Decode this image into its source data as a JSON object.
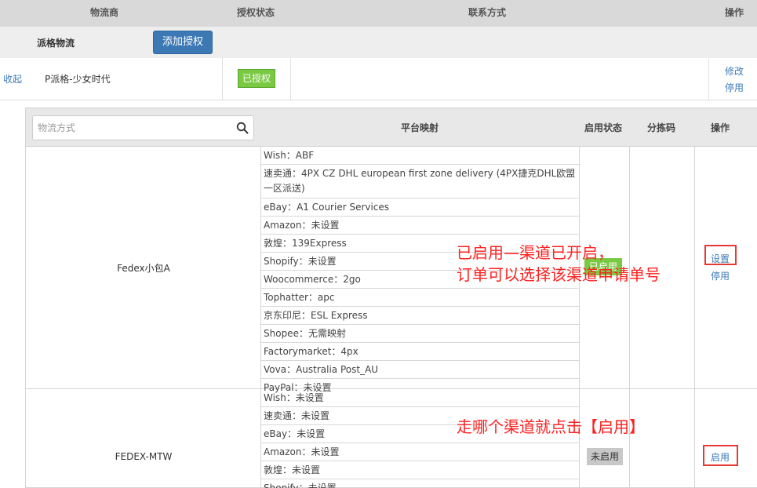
{
  "header": {
    "carrier": "物流商",
    "auth_status": "授权状态",
    "contact": "联系方式",
    "actions": "操作"
  },
  "group": {
    "name": "派格物流",
    "add_auth_button": "添加授权"
  },
  "account": {
    "collapse_link": "收起",
    "name": "P派格-少女时代",
    "auth_badge": "已授权",
    "edit_link": "修改",
    "disable_link": "停用"
  },
  "channel_table": {
    "search_placeholder": "物流方式",
    "col_platform_mapping": "平台映射",
    "col_enable_state": "启用状态",
    "col_sort_code": "分拣码",
    "col_actions": "操作"
  },
  "channels": [
    {
      "name": "Fedex小包A",
      "state": "已启用",
      "settings_link": "设置",
      "disable_link": "停用",
      "mappings": [
        "Wish：ABF",
        "速卖通：4PX CZ DHL european first zone delivery (4PX捷克DHL欧盟一区派送)",
        "eBay：A1 Courier Services",
        "Amazon：未设置",
        "敦煌：139Express",
        "Shopify：未设置",
        "Woocommerce：2go",
        "Tophatter：apc",
        "京东印尼：ESL Express",
        "Shopee：无需映射",
        "Factorymarket：4px",
        "Vova：Australia Post_AU",
        "PayPal：未设置"
      ]
    },
    {
      "name": "FEDEX-MTW",
      "state": "未启用",
      "enable_link": "启用",
      "mappings": [
        "Wish：未设置",
        "速卖通：未设置",
        "eBay：未设置",
        "Amazon：未设置",
        "敦煌：未设置",
        "Shopify：未设置"
      ]
    }
  ],
  "annotations": {
    "enabled_note_line1": "已启用—渠道已开启，",
    "enabled_note_line2": "订单可以选择该渠道申请单号",
    "enable_hint": "走哪个渠道就点击【启用】"
  },
  "colors": {
    "primary_button": "#3c78b4",
    "auth_badge": "#7ac943",
    "link": "#3a7ab8",
    "annotation_red": "#ff2020"
  }
}
